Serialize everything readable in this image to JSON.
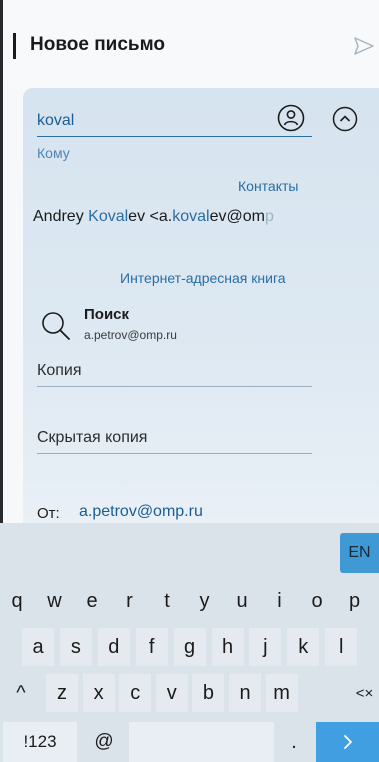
{
  "header": {
    "title": "Новое письмо",
    "send_icon": "send-icon"
  },
  "compose": {
    "to_value": "koval",
    "to_label": "Кому",
    "contacts_header": "Контакты",
    "contact": {
      "first": "Andrey ",
      "last_match": "Koval",
      "last_rest": "ev <a.",
      "email_match": "koval",
      "email_rest": "ev@om",
      "email_fade": "p"
    },
    "web_header": "Интернет-адресная книга",
    "search_title": "Поиск",
    "search_sub": "a.petrov@omp.ru",
    "cc_label": "Копия",
    "bcc_label": "Скрытая копия",
    "from_label": "От:",
    "from_value": "a.petrov@omp.ru"
  },
  "keyboard": {
    "lang": "EN",
    "row1": [
      "q",
      "w",
      "e",
      "r",
      "t",
      "y",
      "u",
      "i",
      "o",
      "p"
    ],
    "row2": [
      "a",
      "s",
      "d",
      "f",
      "g",
      "h",
      "j",
      "k",
      "l"
    ],
    "row3": [
      "z",
      "x",
      "c",
      "v",
      "b",
      "n",
      "m"
    ],
    "shift": "^",
    "backspace": "<×",
    "symbols": "!123",
    "at": "@",
    "dot": ".",
    "enter": "›"
  },
  "colors": {
    "accent": "#2b6ea3",
    "enter": "#3f9fe0",
    "panel": "#d6e4ef"
  }
}
